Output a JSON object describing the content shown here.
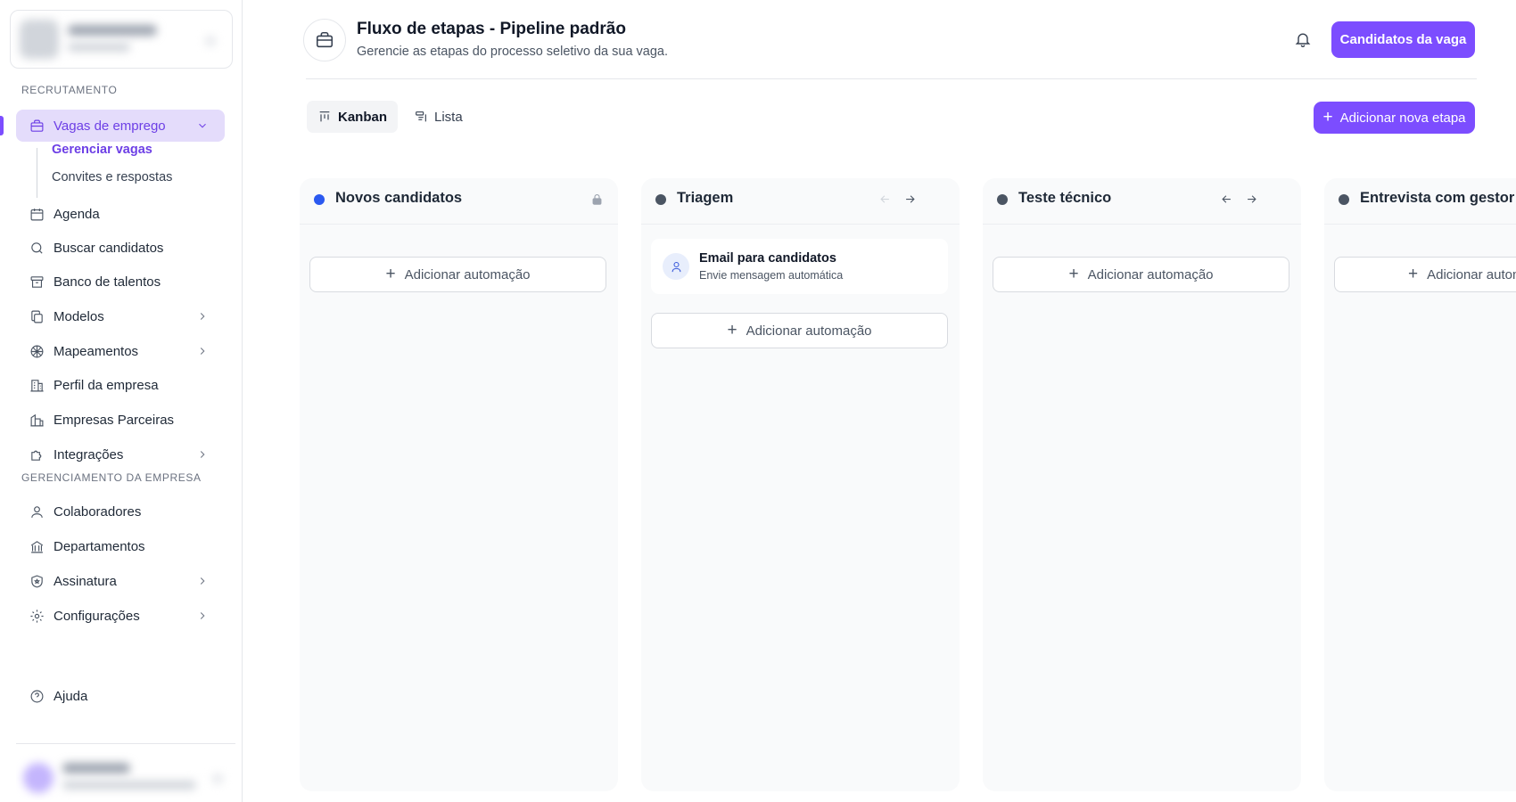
{
  "sidebar": {
    "sections": {
      "recruitment": "RECRUTAMENTO",
      "company": "GERENCIAMENTO DA EMPRESA"
    },
    "items": [
      {
        "label": "Vagas de emprego",
        "icon": "briefcase-icon"
      },
      {
        "label": "Agenda",
        "icon": "calendar-icon"
      },
      {
        "label": "Buscar candidatos",
        "icon": "search-icon"
      },
      {
        "label": "Banco de talentos",
        "icon": "archive-icon"
      },
      {
        "label": "Modelos",
        "icon": "copy-icon"
      },
      {
        "label": "Mapeamentos",
        "icon": "network-icon"
      },
      {
        "label": "Perfil da empresa",
        "icon": "building-icon"
      },
      {
        "label": "Empresas Parceiras",
        "icon": "buildings-icon"
      },
      {
        "label": "Integrações",
        "icon": "puzzle-icon"
      },
      {
        "label": "Colaboradores",
        "icon": "user-icon"
      },
      {
        "label": "Departamentos",
        "icon": "landmark-icon"
      },
      {
        "label": "Assinatura",
        "icon": "shield-icon"
      },
      {
        "label": "Configurações",
        "icon": "gear-icon"
      },
      {
        "label": "Ajuda",
        "icon": "help-icon"
      }
    ],
    "subitems": [
      {
        "label": "Gerenciar vagas"
      },
      {
        "label": "Convites e respostas"
      }
    ]
  },
  "header": {
    "title": "Fluxo de etapas - Pipeline padrão",
    "subtitle": "Gerencie as etapas do processo seletivo da sua vaga.",
    "candidates_button": "Candidatos da vaga"
  },
  "toolbar": {
    "tabs": [
      {
        "label": "Kanban",
        "active": true
      },
      {
        "label": "Lista",
        "active": false
      }
    ],
    "add_stage_button": "Adicionar nova etapa"
  },
  "kanban": {
    "add_automation_label": "Adicionar automação",
    "columns": [
      {
        "title": "Novos candidatos",
        "dot_color": "#2b59f0",
        "locked": true,
        "automations": []
      },
      {
        "title": "Triagem",
        "dot_color": "#4b5563",
        "locked": false,
        "automations": [
          {
            "title": "Email para candidatos",
            "description": "Envie mensagem automática"
          }
        ]
      },
      {
        "title": "Teste técnico",
        "dot_color": "#4b5563",
        "locked": false,
        "automations": []
      },
      {
        "title": "Entrevista com gestor",
        "dot_color": "#4b5563",
        "locked": false,
        "automations": []
      }
    ]
  },
  "colors": {
    "accent": "#7c4dff",
    "accent_soft": "#e4dcfb",
    "new_candidates_dot": "#2b59f0"
  }
}
